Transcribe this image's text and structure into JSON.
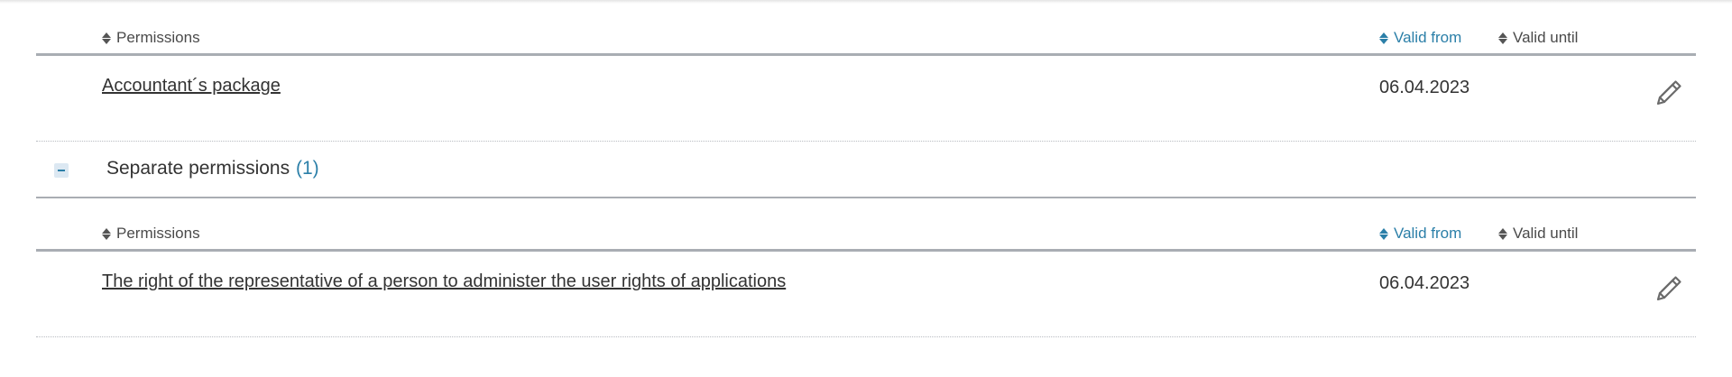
{
  "colors": {
    "accent": "#2b7fa8",
    "text": "#333333",
    "divider": "#a9adb3"
  },
  "package_table": {
    "columns": {
      "permissions": "Permissions",
      "valid_from": "Valid from",
      "valid_until": "Valid until"
    },
    "rows": [
      {
        "permission": "Accountant´s package",
        "valid_from": "06.04.2023",
        "valid_until": "",
        "edit_icon": "pencil-icon"
      }
    ]
  },
  "separate_group": {
    "collapse_icon": "minus-icon",
    "title": "Separate permissions",
    "count": "(1)"
  },
  "separate_table": {
    "columns": {
      "permissions": "Permissions",
      "valid_from": "Valid from",
      "valid_until": "Valid until"
    },
    "rows": [
      {
        "permission": "The right of the representative of a person to administer the user rights of applications",
        "valid_from": "06.04.2023",
        "valid_until": "",
        "edit_icon": "pencil-icon"
      }
    ]
  }
}
